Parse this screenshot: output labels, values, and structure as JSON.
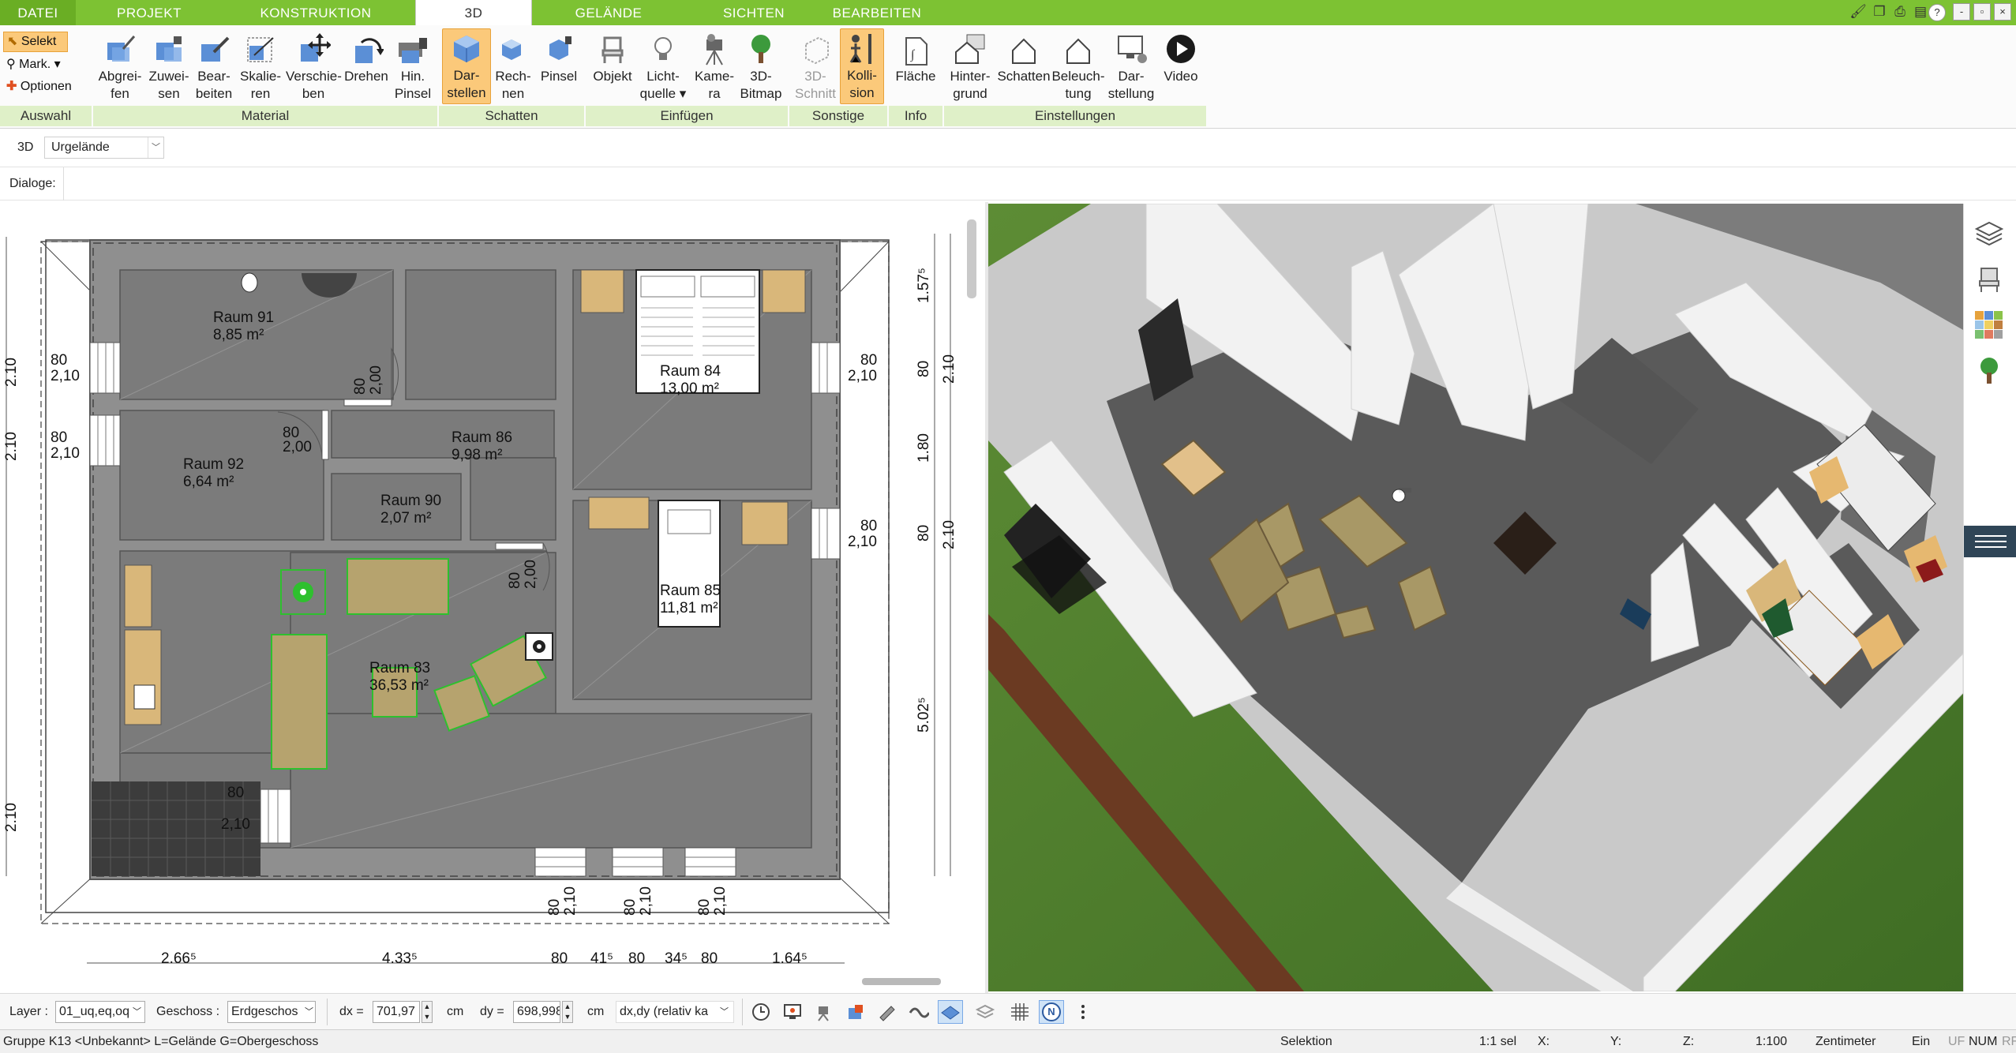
{
  "tabs": [
    {
      "label": "DATEI"
    },
    {
      "label": "PROJEKT"
    },
    {
      "label": "KONSTRUKTION"
    },
    {
      "label": "3D"
    },
    {
      "label": "GELÄNDE"
    },
    {
      "label": "SICHTEN"
    },
    {
      "label": "BEARBEITEN"
    }
  ],
  "window": {
    "minimize": "-",
    "restore": "▫",
    "close": "×",
    "help": "?"
  },
  "ribbon": {
    "selection": {
      "select": "Selekt",
      "mark": "Mark.",
      "options": "Optionen"
    },
    "buttons": {
      "abgreifen": [
        "Abgrei-",
        "fen"
      ],
      "zuweisen": [
        "Zuwei-",
        "sen"
      ],
      "bearbeiten": [
        "Bear-",
        "beiten"
      ],
      "skalieren": [
        "Skalie-",
        "ren"
      ],
      "verschieben": [
        "Verschie-",
        "ben"
      ],
      "drehen": [
        "Drehen",
        ""
      ],
      "hinpinsel": [
        "Hin.",
        "Pinsel"
      ],
      "darstellen": [
        "Dar-",
        "stellen"
      ],
      "rechnen": [
        "Rech-",
        "nen"
      ],
      "pinsel": [
        "Pinsel",
        ""
      ],
      "objekt": [
        "Objekt",
        ""
      ],
      "lichtquelle": [
        "Licht-",
        "quelle ▾"
      ],
      "kamera": [
        "Kame-",
        "ra"
      ],
      "bitmap3d": [
        "3D-",
        "Bitmap"
      ],
      "schnitt3d": [
        "3D-",
        "Schnitt"
      ],
      "kollision": [
        "Kolli-",
        "sion"
      ],
      "flaeche": [
        "Fläche",
        ""
      ],
      "hintergrund": [
        "Hinter-",
        "grund"
      ],
      "schatten": [
        "Schatten",
        ""
      ],
      "beleuchtung": [
        "Beleuch-",
        "tung"
      ],
      "darstellung": [
        "Dar-",
        "stellung"
      ],
      "video": [
        "Video",
        ""
      ]
    },
    "groups": {
      "auswahl": "Auswahl",
      "material": "Material",
      "schatten": "Schatten",
      "einfuegen": "Einfügen",
      "sonstige": "Sonstige",
      "info": "Info",
      "einstellungen": "Einstellungen"
    }
  },
  "subbar": {
    "mode": "3D",
    "terrain": "Urgelände",
    "dialogs": "Dialoge:"
  },
  "plan": {
    "rooms": [
      {
        "name": "Raum 91",
        "area": "8,85 m²"
      },
      {
        "name": "Raum 92",
        "area": "6,64 m²"
      },
      {
        "name": "Raum 86",
        "area": "9,98 m²"
      },
      {
        "name": "Raum 90",
        "area": "2,07 m²"
      },
      {
        "name": "Raum 84",
        "area": "13,00 m²"
      },
      {
        "name": "Raum 85",
        "area": "11,81 m²"
      },
      {
        "name": "Raum 83",
        "area": "36,53 m²"
      }
    ],
    "labels": {
      "w80": "80",
      "h210": "2,10",
      "h200": "2,00",
      "v210": "2.10",
      "v80": "80",
      "d157": "1.57⁵",
      "d180": "1.80",
      "d5025": "5.02⁵",
      "b2665": "2.66⁵",
      "b4335": "4.33⁵",
      "b41": "41⁵",
      "b345": "34⁵",
      "b1645": "1.64⁵"
    }
  },
  "bottombar": {
    "layer_label": "Layer :",
    "layer_value": "01_uq,eq,oq",
    "floor_label": "Geschoss :",
    "floor_value": "Erdgeschos",
    "dx_label": "dx =",
    "dx_value": "701,97",
    "dy_label": "dy =",
    "dy_value": "698,998",
    "unit": "cm",
    "mode_value": "dx,dy (relativ ka",
    "north": "N"
  },
  "status": {
    "info": "Gruppe K13 <Unbekannt> L=Gelände G=Obergeschoss",
    "mode": "Selektion",
    "sel": "1:1 sel",
    "x": "X:",
    "y": "Y:",
    "z": "Z:",
    "scale": "1:100",
    "unit": "Zentimeter",
    "ein": "Ein",
    "uf": "UF",
    "num": "NUM",
    "rf": "RF"
  },
  "colors": {
    "accent_green": "#7dc233",
    "group_bg": "#dff0c8",
    "highlight": "#fbc97a",
    "selection_green": "#2ec02e"
  }
}
